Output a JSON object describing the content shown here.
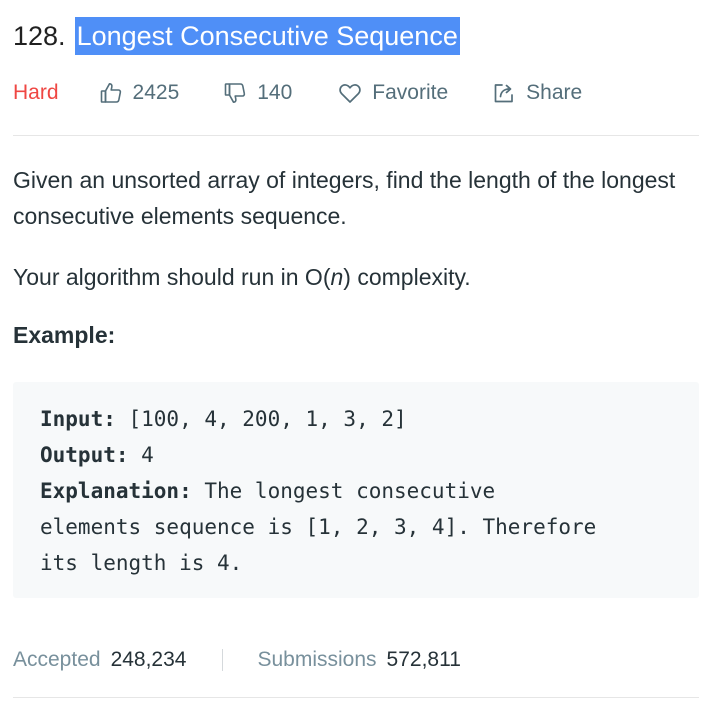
{
  "problem": {
    "number": "128.",
    "title": "Longest Consecutive Sequence",
    "difficulty": "Hard",
    "difficulty_color": "#ef4743"
  },
  "actions": {
    "likes": "2425",
    "likes_icon": "thumbs-up-icon",
    "dislikes": "140",
    "dislikes_icon": "thumbs-down-icon",
    "favorite_label": "Favorite",
    "favorite_icon": "heart-icon",
    "share_label": "Share",
    "share_icon": "share-icon"
  },
  "description": {
    "paragraph1": "Given an unsorted array of integers, find the length of the longest consecutive elements sequence.",
    "paragraph2_prefix": "Your algorithm should run in O(",
    "paragraph2_var": "n",
    "paragraph2_suffix": ") complexity."
  },
  "example": {
    "heading": "Example:",
    "input_label": "Input:",
    "input_value": " [100, 4, 200, 1, 3, 2]",
    "output_label": "Output:",
    "output_value": " 4",
    "explanation_label": "Explanation:",
    "explanation_line1": " The longest consecutive",
    "explanation_line2": "elements sequence is [1, 2, 3, 4]. Therefore",
    "explanation_line3": "its length is 4."
  },
  "stats": {
    "accepted_label": "Accepted",
    "accepted_value": "248,234",
    "submissions_label": "Submissions",
    "submissions_value": "572,811"
  },
  "colors": {
    "title_highlight": "#4f8ff7",
    "muted_text": "#546e7a",
    "code_background": "#f7f9fa"
  }
}
